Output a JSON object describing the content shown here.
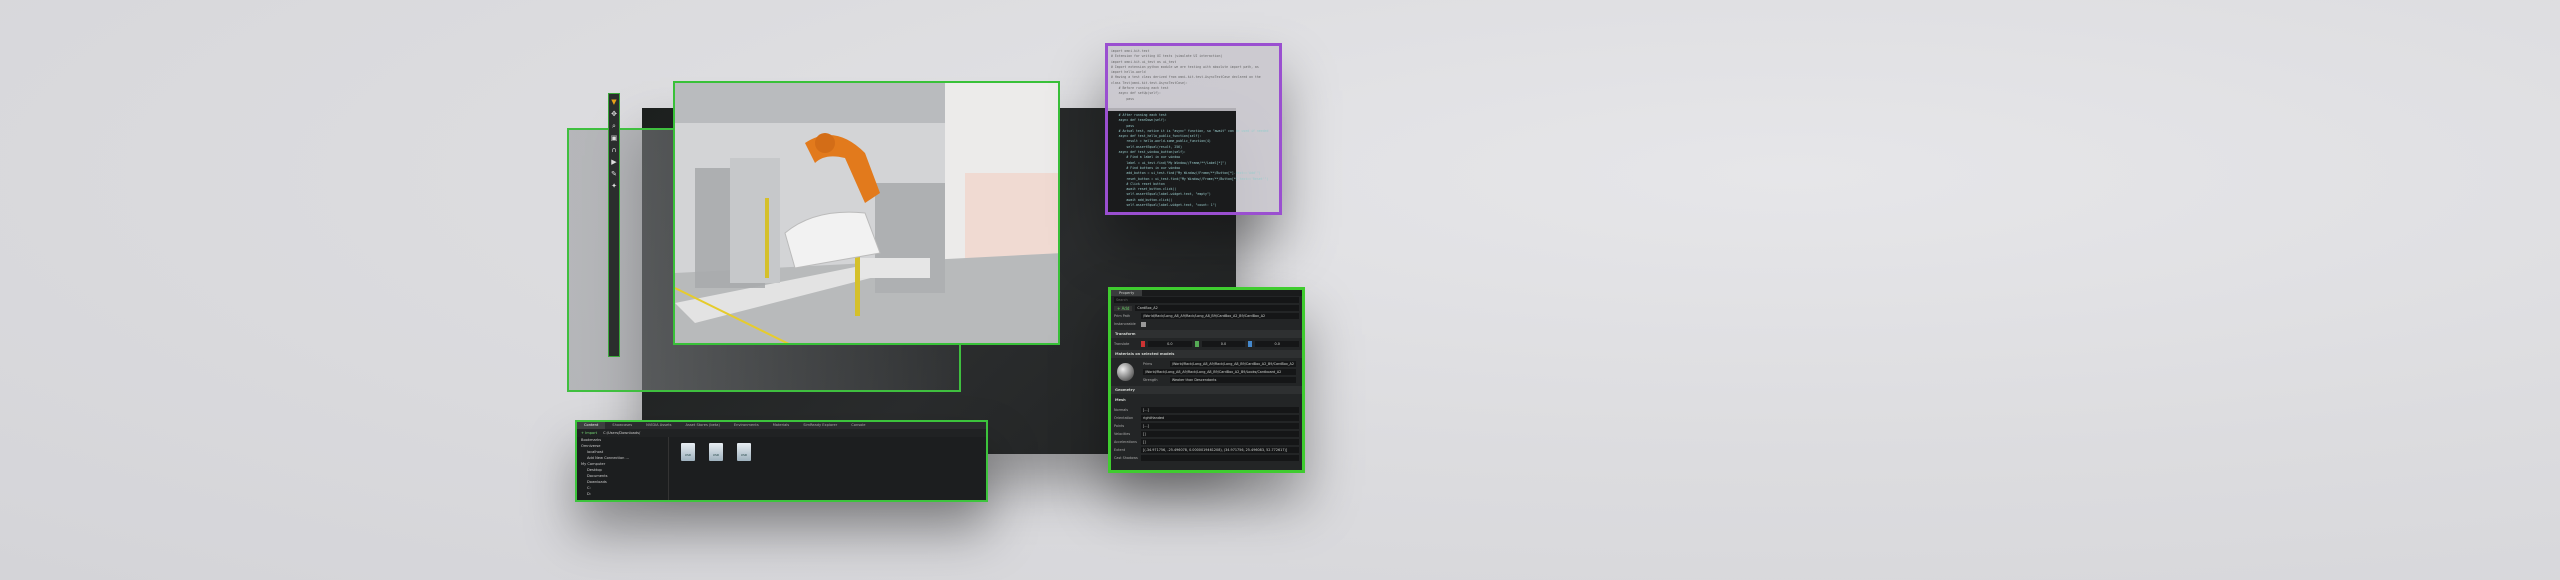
{
  "toolbar": {
    "icons": [
      "select-icon",
      "move-icon",
      "zoom-icon",
      "snap-icon",
      "magnet-icon",
      "play-icon",
      "paint-icon",
      "light-icon"
    ]
  },
  "code": {
    "lines_light": [
      "import omni.kit.test",
      "# Extension for writing UI tests (simulate UI interaction)",
      "import omni.kit.ui_test as ui_test",
      "# Import extension python module we are testing with absolute import path, as",
      "import hello.world",
      "# Having a test class derived from omni.kit.test.AsyncTestCase declared on the",
      "class Test(omni.kit.test.AsyncTestCase):",
      "    # Before running each test",
      "    async def setUp(self):",
      "        pass"
    ],
    "lines_dark": [
      "    # After running each test",
      "    async def tearDown(self):",
      "        pass",
      "    # Actual test, notice it is \"async\" function, so \"await\" can be used if needed",
      "    async def test_hello_public_function(self):",
      "        result = hello.world.some_public_function(4)",
      "        self.assertEqual(result, 256)",
      "",
      "    async def test_window_button(self):",
      "        # Find a label in our window",
      "        label = ui_test.find(\"My Window//Frame/**/Label[*]\")",
      "        # Find buttons in our window",
      "        add_button = ui_test.find(\"My Window//Frame/**/Button[*].text=='Add'\")",
      "        reset_button = ui_test.find(\"My Window//Frame/**/Button[*].text=='Reset'\")",
      "        # Click reset button",
      "        await reset_button.click()",
      "        self.assertEqual(label.widget.text, \"empty\")",
      "        await add_button.click()",
      "        self.assertEqual(label.widget.text, \"count: 1\")"
    ]
  },
  "props": {
    "tab": "Property",
    "search": "Search",
    "add": "Add",
    "name": "CardBox_A2",
    "prim_path_label": "Prim Path",
    "prim_path": "/World/Rack/Long_A8_A9/Rack/Long_A8_B9/CardBox_A2_B9/CardBox_A2",
    "instanceable_label": "Instanceable",
    "transform": "Transform",
    "translate_label": "Translate",
    "x": "0.0",
    "y": "0.0",
    "z": "0.0",
    "materials": "Materials on selected models",
    "prims_label": "Prims",
    "prims": "/World/Rack/Long_A8_A9/Rack/Long_A8_B9/CardBox_A2_B9/CardBox_A2",
    "material": "/World/Rack/Long_A8_A9/Rack/Long_A8_B9/CardBox_A2_B9/Looks/Cardboard_A2",
    "strength_label": "Strength",
    "strength": "Weaker than Descendants",
    "geometry": "Geometry",
    "mesh": "Mesh",
    "rows": [
      {
        "label": "Normals",
        "value": "[...]"
      },
      {
        "label": "Orientation",
        "value": "rightHanded"
      },
      {
        "label": "Points",
        "value": "[...]"
      },
      {
        "label": "Velocities",
        "value": "[]"
      },
      {
        "label": "Accelerations",
        "value": "[]"
      },
      {
        "label": "Extent",
        "value": "[(-34.971756, -25.496078, 0.0000019461208), (34.971756, 25.496083, 52.772617)]"
      },
      {
        "label": "Cast Shadows",
        "value": ""
      }
    ]
  },
  "content": {
    "tabs": [
      "Content",
      "Showcases",
      "NVIDIA Assets",
      "Asset Stores (beta)",
      "Environments",
      "Materials",
      "SimReady Explorer",
      "Console"
    ],
    "import": "Import",
    "path": "C:/Users/Downloads/",
    "tree": [
      "Bookmarks",
      "Omniverse",
      "localhost",
      "Add New Connection ...",
      "My Computer",
      "Desktop",
      "Documents",
      "Downloads",
      "C:",
      "D:"
    ],
    "files": [
      "USD",
      "USD",
      "USD"
    ]
  }
}
